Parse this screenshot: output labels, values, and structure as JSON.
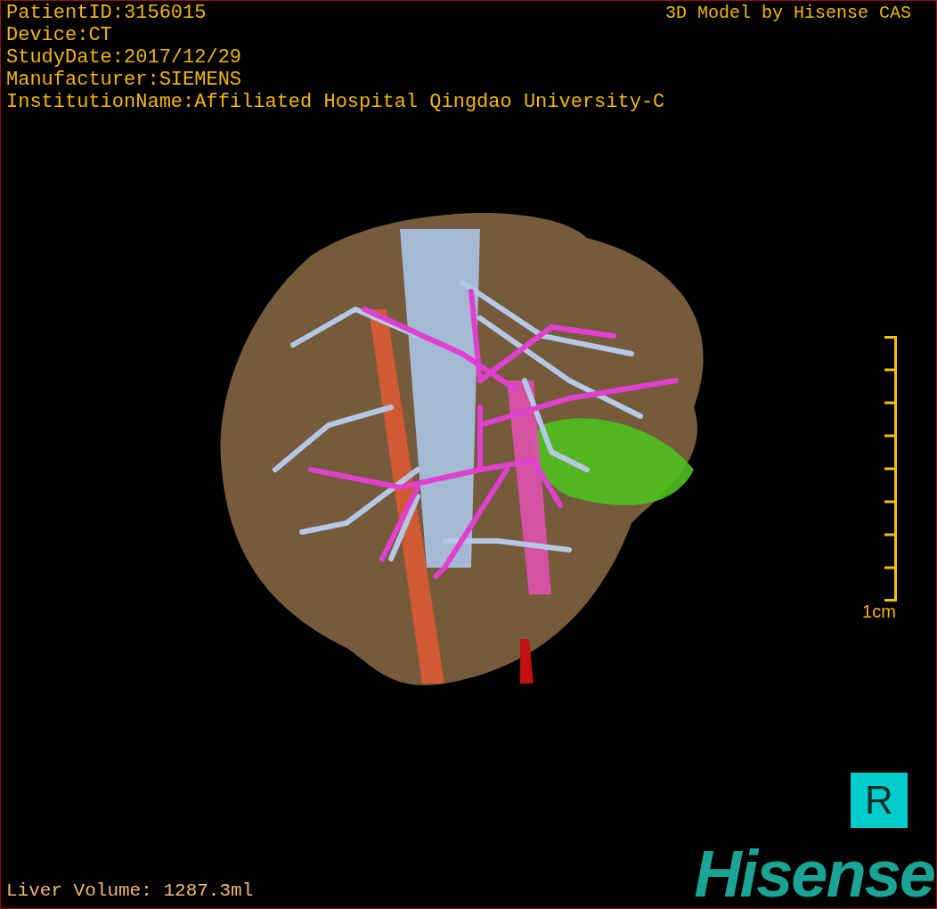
{
  "info_lines": [
    "PatientID:3156015",
    "Device:CT",
    "StudyDate:2017/12/29",
    "Manufacturer:SIEMENS",
    "InstitutionName:Affiliated Hospital Qingdao University-C"
  ],
  "title": "3D Model by Hisense CAS",
  "scale_bar": {
    "label": "1cm"
  },
  "liver_volume": "Liver Volume: 1287.3ml",
  "orientation_marker": "R",
  "logo": "Hisense"
}
